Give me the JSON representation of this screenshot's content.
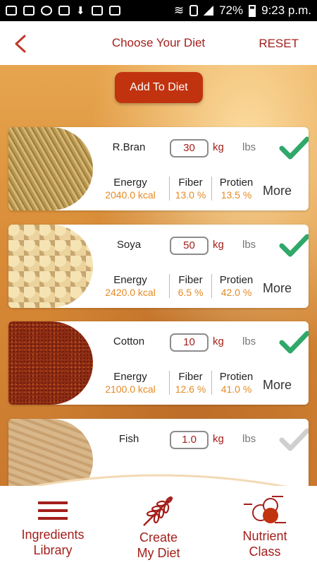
{
  "status": {
    "battery": "72%",
    "time": "9:23 p.m."
  },
  "header": {
    "title": "Choose Your Diet",
    "reset": "RESET"
  },
  "add_button": "Add To Diet",
  "items": [
    {
      "name": "R.Bran",
      "qty": "30",
      "unit_kg": "kg",
      "unit_lbs": "lbs",
      "checked": true,
      "energy_label": "Energy",
      "energy": "2040.0 kcal",
      "fiber_label": "Fiber",
      "fiber": "13.0 %",
      "protein_label": "Protien",
      "protein": "13.5 %",
      "more": "More"
    },
    {
      "name": "Soya",
      "qty": "50",
      "unit_kg": "kg",
      "unit_lbs": "lbs",
      "checked": true,
      "energy_label": "Energy",
      "energy": "2420.0 kcal",
      "fiber_label": "Fiber",
      "fiber": "6.5 %",
      "protein_label": "Protien",
      "protein": "42.0 %",
      "more": "More"
    },
    {
      "name": "Cotton",
      "qty": "10",
      "unit_kg": "kg",
      "unit_lbs": "lbs",
      "checked": true,
      "energy_label": "Energy",
      "energy": "2100.0 kcal",
      "fiber_label": "Fiber",
      "fiber": "12.6 %",
      "protein_label": "Protien",
      "protein": "41.0 %",
      "more": "More"
    },
    {
      "name": "Fish",
      "qty": "1.0",
      "unit_kg": "kg",
      "unit_lbs": "lbs",
      "checked": false
    }
  ],
  "nav": {
    "ingredients_line1": "Ingredients",
    "ingredients_line2": "Library",
    "create_line1": "Create",
    "create_line2": "My Diet",
    "nutrient_line1": "Nutrient",
    "nutrient_line2": "Class"
  },
  "colors": {
    "accent": "#a31f1b",
    "button": "#c1330f",
    "check_on": "#2fa86a",
    "check_off": "#cfcfcf",
    "value": "#e58a25"
  }
}
